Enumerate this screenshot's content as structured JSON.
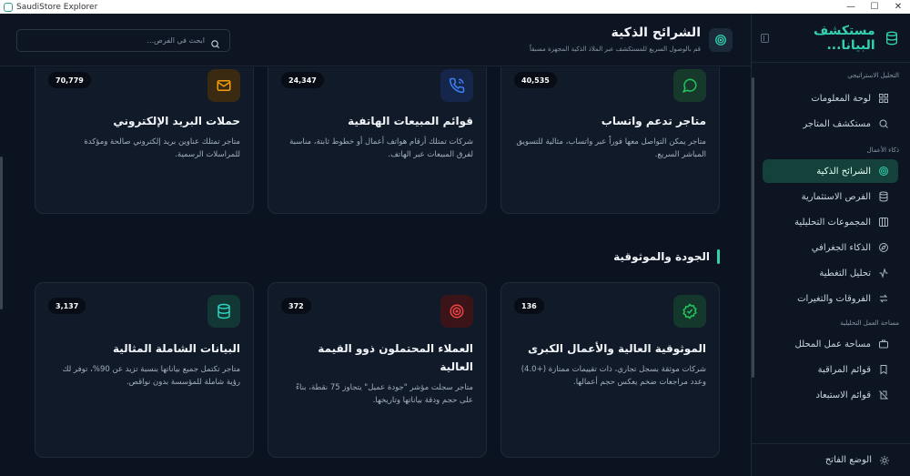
{
  "window": {
    "title": "SaudiStore Explorer",
    "controls": [
      "—",
      "☐",
      "✕"
    ]
  },
  "sidebar": {
    "app_name": "مستكشف البيانا...",
    "sections": [
      {
        "label": "التحليل الاستراتيجي",
        "items": [
          {
            "label": "لوحة المعلومات",
            "icon": "grid-icon"
          },
          {
            "label": "مستكشف المتاجر",
            "icon": "search-icon"
          }
        ]
      },
      {
        "label": "ذكاء الأعمال",
        "items": [
          {
            "label": "الشرائح الذكية",
            "icon": "target-icon",
            "active": true
          },
          {
            "label": "الفرص الاستثمارية",
            "icon": "database-icon"
          },
          {
            "label": "المجموعات التحليلية",
            "icon": "columns-icon"
          },
          {
            "label": "الذكاء الجغرافي",
            "icon": "compass-icon"
          },
          {
            "label": "تحليل التغطية",
            "icon": "activity-icon"
          },
          {
            "label": "الفروقات والتغيرات",
            "icon": "swap-icon"
          }
        ]
      },
      {
        "label": "مساحة العمل التحليلية",
        "items": [
          {
            "label": "مساحة عمل المحلل",
            "icon": "briefcase-icon"
          },
          {
            "label": "قوائم المراقبة",
            "icon": "bookmark-icon"
          },
          {
            "label": "قوائم الاستبعاد",
            "icon": "slash-icon"
          }
        ]
      }
    ],
    "footer_label": "الوضع الفاتح"
  },
  "header": {
    "title": "الشرائح الذكية",
    "subtitle": "قم بالوصول السريع للمستكشف عبر الملاذ الذكية المجهزة مسبقاً",
    "search_placeholder": "ابحث في الفرص..."
  },
  "cards_top": [
    {
      "count": "40,535",
      "title": "متاجر تدعم واتساب",
      "desc": "متاجر يمكن التواصل معها فوراً عبر واتساب، مثالية للتسويق المباشر السريع.",
      "icon": "whatsapp-icon",
      "color": "#22c55e"
    },
    {
      "count": "24,347",
      "title": "قوائم المبيعات الهاتفية",
      "desc": "شركات تمتلك أرقام هواتف أعمال أو خطوط ثابتة، مناسبة لفرق المبيعات عبر الهاتف.",
      "icon": "phone-icon",
      "color": "#3b82f6"
    },
    {
      "count": "70,779",
      "title": "حملات البريد الإلكتروني",
      "desc": "متاجر تمتلك عناوين بريد إلكتروني صالحة ومؤكدة للمراسلات الرسمية.",
      "icon": "mail-icon",
      "color": "#f59e0b"
    }
  ],
  "section": {
    "title": "الجودة والموثوقية"
  },
  "cards_bottom": [
    {
      "count": "136",
      "title": "الموثوقية العالية والأعمال الكبرى",
      "desc": "شركات موثقة بسجل تجاري، ذات تقييمات ممتازة (+4.0) وعدد مراجعات ضخم يعكس حجم أعمالها.",
      "icon": "badge-check-icon",
      "color": "#22c55e"
    },
    {
      "count": "372",
      "title": "العملاء المحتملون ذوو القيمة العالية",
      "desc": "متاجر سجلت مؤشر \"جودة عميل\" يتجاوز 75 نقطة، بناءً على حجم ودقة بياناتها وتاريخها.",
      "icon": "target-icon",
      "color": "#ef4444"
    },
    {
      "count": "3,137",
      "title": "البيانات الشاملة المثالية",
      "desc": "متاجر تكتمل جميع بياناتها بنسبة تزيد عن 90%، توفر لك رؤية شاملة للمؤسسة بدون نواقص.",
      "icon": "database-icon",
      "color": "#2dd4bf"
    }
  ]
}
